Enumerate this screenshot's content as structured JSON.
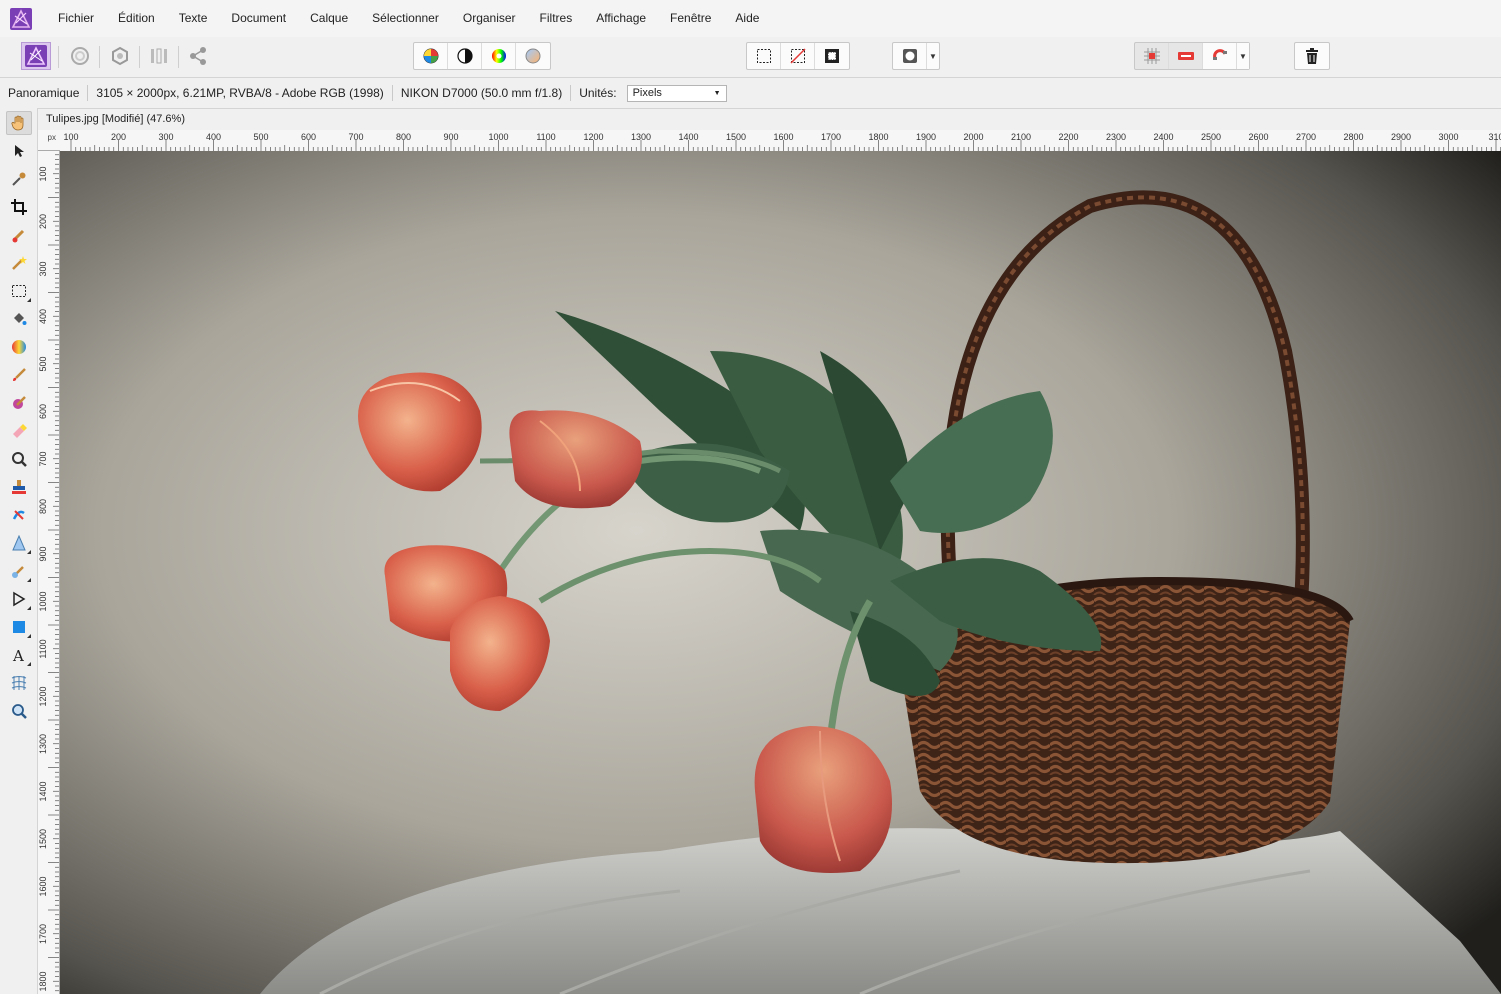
{
  "menu": [
    "Fichier",
    "Édition",
    "Texte",
    "Document",
    "Calque",
    "Sélectionner",
    "Organiser",
    "Filtres",
    "Affichage",
    "Fenêtre",
    "Aide"
  ],
  "toolbar": {
    "personas": [
      "photo-persona-icon",
      "liquify-persona-icon",
      "develop-persona-icon",
      "tone-mapping-persona-icon",
      "export-persona-icon"
    ],
    "adjust_group": [
      "auto-levels-icon",
      "auto-contrast-icon",
      "auto-colors-icon",
      "auto-white-balance-icon"
    ],
    "selection_group": [
      "marquee-selection-icon",
      "deselect-icon",
      "invert-selection-icon"
    ],
    "mask_icon": "quick-mask-icon",
    "snap_group": [
      "snapping-icon",
      "assistant-icon",
      "magnet-icon"
    ],
    "delete_icon": "trash-icon"
  },
  "context": {
    "tool_name": "Panoramique",
    "doc_info": "3105 × 2000px, 6.21MP, RVBA/8 - Adobe RGB (1998)",
    "camera_info": "NIKON D7000 (50.0 mm f/1.8)",
    "units_label": "Unités:",
    "units_value": "Pixels"
  },
  "document": {
    "tab_title": "Tulipes.jpg [Modifié] (47.6%)"
  },
  "ruler": {
    "unit": "px",
    "h_ticks": [
      "100",
      "200",
      "300",
      "400",
      "500",
      "600",
      "700",
      "800",
      "900",
      "1000",
      "1100",
      "1200",
      "1300",
      "1400",
      "1500",
      "1600",
      "1700",
      "1800",
      "1900",
      "2000",
      "2100",
      "2200",
      "2300",
      "2400",
      "2500",
      "2600",
      "2700",
      "2800",
      "2900",
      "3000",
      "310"
    ],
    "v_ticks": [
      "100",
      "200",
      "300",
      "400",
      "500",
      "600",
      "700",
      "800",
      "900",
      "1000",
      "1100",
      "1200",
      "1300",
      "1400",
      "1500",
      "1600",
      "1700",
      "1800"
    ]
  },
  "tools": [
    "hand-icon",
    "move-icon",
    "color-picker-icon",
    "crop-icon",
    "selection-brush-icon",
    "magic-wand-icon",
    "rectangle-marquee-icon",
    "flood-fill-icon",
    "gradient-icon",
    "paint-brush-icon",
    "pixel-brush-icon",
    "eraser-icon",
    "dodge-icon",
    "clone-stamp-icon",
    "blemish-icon",
    "sharpen-icon",
    "smudge-icon",
    "pen-icon",
    "shape-icon",
    "text-icon",
    "mesh-warp-icon",
    "zoom-icon"
  ],
  "colors": {
    "accent": "#7b3fb5",
    "toolbar_bg": "#f0f0f0"
  }
}
